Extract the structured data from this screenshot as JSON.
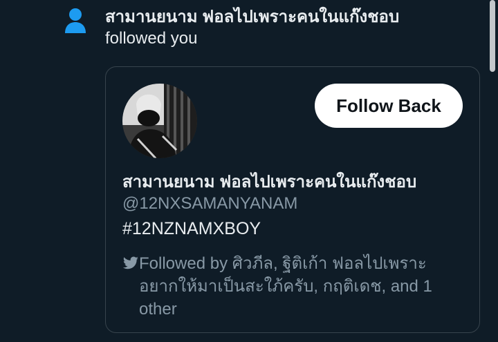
{
  "notification": {
    "icon": "person-icon",
    "icon_color": "#1d9bf0",
    "name": "สามานยนาม ฟอลไปเพราะคนในแก๊งชอบ",
    "action": "followed you"
  },
  "card": {
    "avatar": "profile-avatar",
    "follow_button_label": "Follow Back",
    "display_name": "สามานยนาม ฟอลไปเพราะคนในแก๊งชอบ",
    "handle": "@12NXSAMANYANAM",
    "bio": "#12NZNAMXBOY",
    "followed_by_icon": "bird-icon",
    "followed_by_text": "Followed by ศิวภีล, ฐิติเก้า ฟอลไปเพราะอยากให้มาเป็นสะใภ้ครับ, กฤติเดช, and 1 other"
  },
  "colors": {
    "background": "#0f1c27",
    "accent": "#1d9bf0",
    "muted_text": "#8899a6",
    "border": "#38444d"
  }
}
